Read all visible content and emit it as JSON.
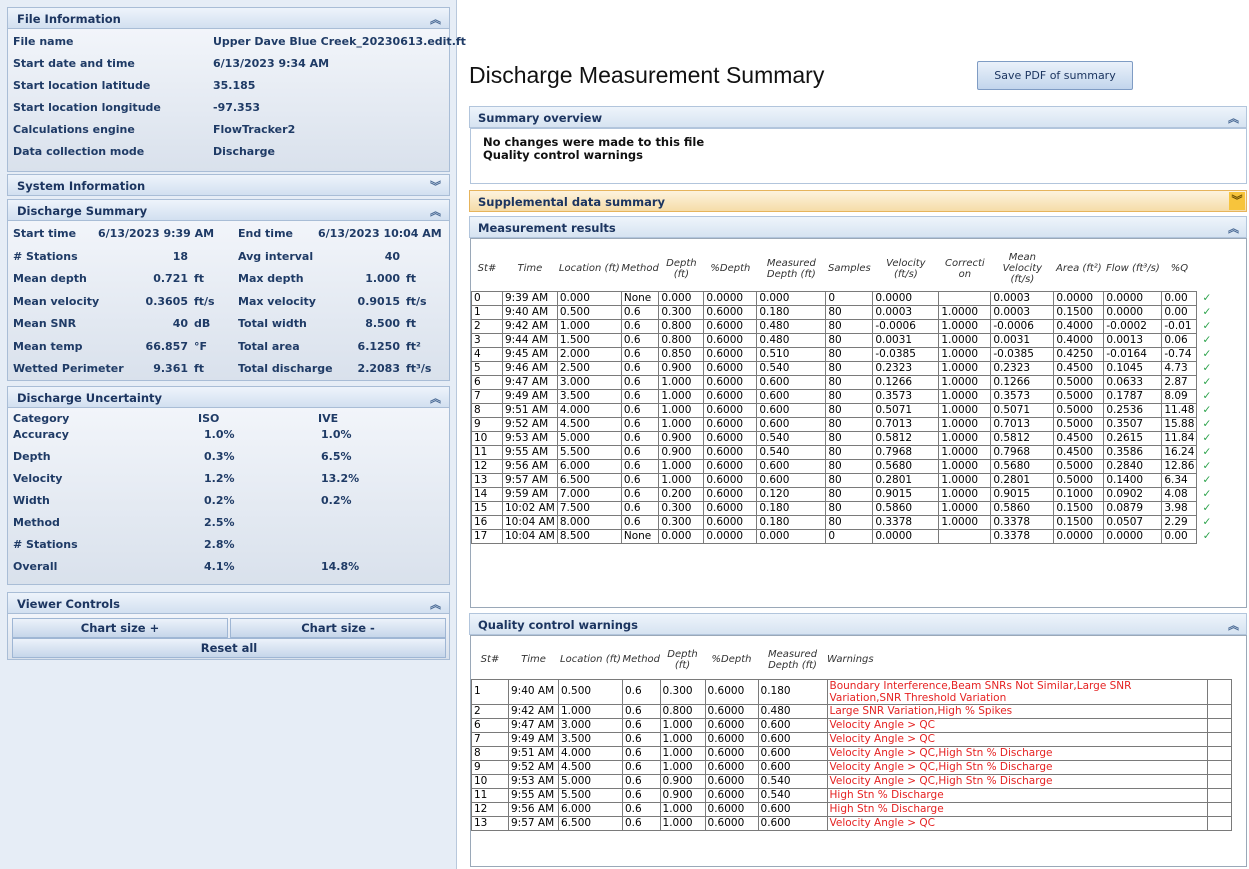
{
  "file_info": {
    "header": "File Information",
    "rows": [
      {
        "label": "File name",
        "value": "Upper Dave Blue Creek_20230613.edit.ft"
      },
      {
        "label": "Start date and time",
        "value": "6/13/2023 9:34 AM"
      },
      {
        "label": "Start location latitude",
        "value": "35.185"
      },
      {
        "label": "Start location longitude",
        "value": "-97.353"
      },
      {
        "label": "Calculations engine",
        "value": "FlowTracker2"
      },
      {
        "label": "Data collection mode",
        "value": "Discharge"
      }
    ]
  },
  "system_info": {
    "header": "System Information"
  },
  "discharge_summary": {
    "header": "Discharge Summary",
    "rows": [
      {
        "l1": "Start time",
        "v1": "6/13/2023 9:39 AM",
        "u1": "",
        "l2": "End time",
        "v2": "6/13/2023 10:04 AM",
        "u2": ""
      },
      {
        "l1": "# Stations",
        "v1": "18",
        "u1": "",
        "l2": "Avg interval",
        "v2": "40",
        "u2": ""
      },
      {
        "l1": "Mean depth",
        "v1": "0.721",
        "u1": "ft",
        "l2": "Max depth",
        "v2": "1.000",
        "u2": "ft"
      },
      {
        "l1": "Mean velocity",
        "v1": "0.3605",
        "u1": "ft/s",
        "l2": "Max velocity",
        "v2": "0.9015",
        "u2": "ft/s"
      },
      {
        "l1": "Mean SNR",
        "v1": "40",
        "u1": "dB",
        "l2": "Total width",
        "v2": "8.500",
        "u2": "ft"
      },
      {
        "l1": "Mean temp",
        "v1": "66.857",
        "u1": "°F",
        "l2": "Total area",
        "v2": "6.1250",
        "u2": "ft²"
      },
      {
        "l1": "Wetted Perimeter",
        "v1": "9.361",
        "u1": "ft",
        "l2": "Total discharge",
        "v2": "2.2083",
        "u2": "ft³/s"
      }
    ]
  },
  "uncertainty": {
    "header": "Discharge Uncertainty",
    "col_category": "Category",
    "col_iso": "ISO",
    "col_ive": "IVE",
    "rows": [
      {
        "cat": "Accuracy",
        "iso": "1.0%",
        "ive": "1.0%"
      },
      {
        "cat": "Depth",
        "iso": "0.3%",
        "ive": "6.5%"
      },
      {
        "cat": "Velocity",
        "iso": "1.2%",
        "ive": "13.2%"
      },
      {
        "cat": "Width",
        "iso": "0.2%",
        "ive": "0.2%"
      },
      {
        "cat": "Method",
        "iso": "2.5%",
        "ive": ""
      },
      {
        "cat": "# Stations",
        "iso": "2.8%",
        "ive": ""
      },
      {
        "cat": "Overall",
        "iso": "4.1%",
        "ive": "14.8%"
      }
    ]
  },
  "viewer_controls": {
    "header": "Viewer Controls",
    "chart_plus": "Chart size +",
    "chart_minus": "Chart size -",
    "reset": "Reset all"
  },
  "title": "Discharge Measurement Summary",
  "save_pdf": "Save PDF of summary",
  "summary_overview": {
    "header": "Summary overview",
    "line1": "No changes were made to this file",
    "line2": "Quality control warnings"
  },
  "supplemental": {
    "header": "Supplemental data summary"
  },
  "measurement": {
    "header": "Measurement results",
    "columns": [
      "St#",
      "Time",
      "Location (ft)",
      "Method",
      "Depth (ft)",
      "%Depth",
      "Measured Depth (ft)",
      "Samples",
      "Velocity (ft/s)",
      "Correcti on",
      "Mean Velocity (ft/s)",
      "Area (ft²)",
      "Flow (ft³/s)",
      "%Q"
    ],
    "rows": [
      [
        "0",
        "9:39 AM",
        "0.000",
        "None",
        "0.000",
        "0.0000",
        "0.000",
        "0",
        "0.0000",
        "",
        "0.0003",
        "0.0000",
        "0.0000",
        "0.00"
      ],
      [
        "1",
        "9:40 AM",
        "0.500",
        "0.6",
        "0.300",
        "0.6000",
        "0.180",
        "80",
        "0.0003",
        "1.0000",
        "0.0003",
        "0.1500",
        "0.0000",
        "0.00"
      ],
      [
        "2",
        "9:42 AM",
        "1.000",
        "0.6",
        "0.800",
        "0.6000",
        "0.480",
        "80",
        "-0.0006",
        "1.0000",
        "-0.0006",
        "0.4000",
        "-0.0002",
        "-0.01"
      ],
      [
        "3",
        "9:44 AM",
        "1.500",
        "0.6",
        "0.800",
        "0.6000",
        "0.480",
        "80",
        "0.0031",
        "1.0000",
        "0.0031",
        "0.4000",
        "0.0013",
        "0.06"
      ],
      [
        "4",
        "9:45 AM",
        "2.000",
        "0.6",
        "0.850",
        "0.6000",
        "0.510",
        "80",
        "-0.0385",
        "1.0000",
        "-0.0385",
        "0.4250",
        "-0.0164",
        "-0.74"
      ],
      [
        "5",
        "9:46 AM",
        "2.500",
        "0.6",
        "0.900",
        "0.6000",
        "0.540",
        "80",
        "0.2323",
        "1.0000",
        "0.2323",
        "0.4500",
        "0.1045",
        "4.73"
      ],
      [
        "6",
        "9:47 AM",
        "3.000",
        "0.6",
        "1.000",
        "0.6000",
        "0.600",
        "80",
        "0.1266",
        "1.0000",
        "0.1266",
        "0.5000",
        "0.0633",
        "2.87"
      ],
      [
        "7",
        "9:49 AM",
        "3.500",
        "0.6",
        "1.000",
        "0.6000",
        "0.600",
        "80",
        "0.3573",
        "1.0000",
        "0.3573",
        "0.5000",
        "0.1787",
        "8.09"
      ],
      [
        "8",
        "9:51 AM",
        "4.000",
        "0.6",
        "1.000",
        "0.6000",
        "0.600",
        "80",
        "0.5071",
        "1.0000",
        "0.5071",
        "0.5000",
        "0.2536",
        "11.48"
      ],
      [
        "9",
        "9:52 AM",
        "4.500",
        "0.6",
        "1.000",
        "0.6000",
        "0.600",
        "80",
        "0.7013",
        "1.0000",
        "0.7013",
        "0.5000",
        "0.3507",
        "15.88"
      ],
      [
        "10",
        "9:53 AM",
        "5.000",
        "0.6",
        "0.900",
        "0.6000",
        "0.540",
        "80",
        "0.5812",
        "1.0000",
        "0.5812",
        "0.4500",
        "0.2615",
        "11.84"
      ],
      [
        "11",
        "9:55 AM",
        "5.500",
        "0.6",
        "0.900",
        "0.6000",
        "0.540",
        "80",
        "0.7968",
        "1.0000",
        "0.7968",
        "0.4500",
        "0.3586",
        "16.24"
      ],
      [
        "12",
        "9:56 AM",
        "6.000",
        "0.6",
        "1.000",
        "0.6000",
        "0.600",
        "80",
        "0.5680",
        "1.0000",
        "0.5680",
        "0.5000",
        "0.2840",
        "12.86"
      ],
      [
        "13",
        "9:57 AM",
        "6.500",
        "0.6",
        "1.000",
        "0.6000",
        "0.600",
        "80",
        "0.2801",
        "1.0000",
        "0.2801",
        "0.5000",
        "0.1400",
        "6.34"
      ],
      [
        "14",
        "9:59 AM",
        "7.000",
        "0.6",
        "0.200",
        "0.6000",
        "0.120",
        "80",
        "0.9015",
        "1.0000",
        "0.9015",
        "0.1000",
        "0.0902",
        "4.08"
      ],
      [
        "15",
        "10:02 AM",
        "7.500",
        "0.6",
        "0.300",
        "0.6000",
        "0.180",
        "80",
        "0.5860",
        "1.0000",
        "0.5860",
        "0.1500",
        "0.0879",
        "3.98"
      ],
      [
        "16",
        "10:04 AM",
        "8.000",
        "0.6",
        "0.300",
        "0.6000",
        "0.180",
        "80",
        "0.3378",
        "1.0000",
        "0.3378",
        "0.1500",
        "0.0507",
        "2.29"
      ],
      [
        "17",
        "10:04 AM",
        "8.500",
        "None",
        "0.000",
        "0.0000",
        "0.000",
        "0",
        "0.0000",
        "",
        "0.3378",
        "0.0000",
        "0.0000",
        "0.00"
      ]
    ]
  },
  "qc": {
    "header": "Quality control warnings",
    "columns": [
      "St#",
      "Time",
      "Location (ft)",
      "Method",
      "Depth (ft)",
      "%Depth",
      "Measured Depth (ft)",
      "Warnings"
    ],
    "rows": [
      [
        "1",
        "9:40 AM",
        "0.500",
        "0.6",
        "0.300",
        "0.6000",
        "0.180",
        "Boundary Interference,Beam SNRs Not Similar,Large SNR Variation,SNR Threshold Variation"
      ],
      [
        "2",
        "9:42 AM",
        "1.000",
        "0.6",
        "0.800",
        "0.6000",
        "0.480",
        "Large SNR Variation,High % Spikes"
      ],
      [
        "6",
        "9:47 AM",
        "3.000",
        "0.6",
        "1.000",
        "0.6000",
        "0.600",
        "Velocity Angle > QC"
      ],
      [
        "7",
        "9:49 AM",
        "3.500",
        "0.6",
        "1.000",
        "0.6000",
        "0.600",
        "Velocity Angle > QC"
      ],
      [
        "8",
        "9:51 AM",
        "4.000",
        "0.6",
        "1.000",
        "0.6000",
        "0.600",
        "Velocity Angle > QC,High Stn % Discharge"
      ],
      [
        "9",
        "9:52 AM",
        "4.500",
        "0.6",
        "1.000",
        "0.6000",
        "0.600",
        "Velocity Angle > QC,High Stn % Discharge"
      ],
      [
        "10",
        "9:53 AM",
        "5.000",
        "0.6",
        "0.900",
        "0.6000",
        "0.540",
        "Velocity Angle > QC,High Stn % Discharge"
      ],
      [
        "11",
        "9:55 AM",
        "5.500",
        "0.6",
        "0.900",
        "0.6000",
        "0.540",
        "High Stn % Discharge"
      ],
      [
        "12",
        "9:56 AM",
        "6.000",
        "0.6",
        "1.000",
        "0.6000",
        "0.600",
        "High Stn % Discharge"
      ],
      [
        "13",
        "9:57 AM",
        "6.500",
        "0.6",
        "1.000",
        "0.6000",
        "0.600",
        "Velocity Angle > QC"
      ]
    ]
  },
  "icons": {
    "collapse": "double-chevron-up-icon",
    "expand": "double-chevron-down-icon",
    "check": "check-icon"
  },
  "colors": {
    "accent": "#1c3560",
    "warning_text": "#e52222",
    "check": "#2aa24a",
    "supplemental_highlight": "#f7c43c"
  }
}
